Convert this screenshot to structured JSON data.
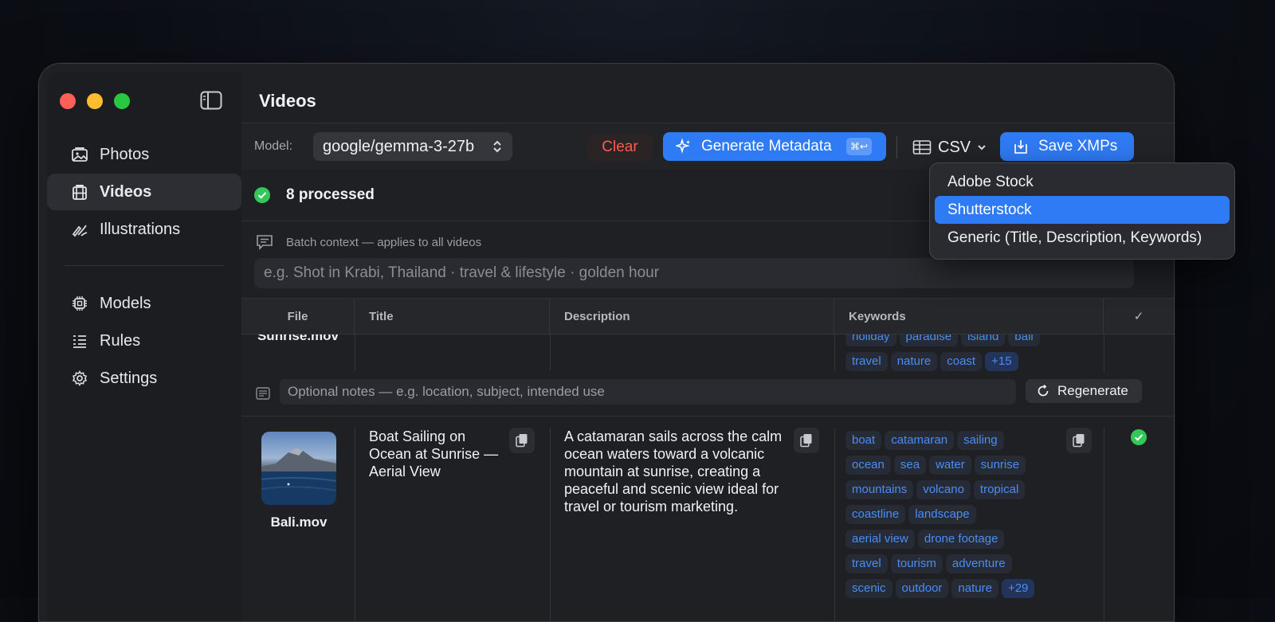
{
  "window": {
    "title": "Videos"
  },
  "sidebar": {
    "items": [
      {
        "label": "Photos",
        "icon": "photo-icon"
      },
      {
        "label": "Videos",
        "icon": "film-icon"
      },
      {
        "label": "Illustrations",
        "icon": "brush-icon"
      },
      {
        "label": "Models",
        "icon": "chip-icon"
      },
      {
        "label": "Rules",
        "icon": "list-icon"
      },
      {
        "label": "Settings",
        "icon": "gear-icon"
      }
    ],
    "active": "Videos"
  },
  "toolbar": {
    "model_label": "Model:",
    "model_value": "google/gemma-3-27b",
    "clear_label": "Clear",
    "generate_label": "Generate Metadata",
    "generate_shortcut": "⌘↩",
    "export_format": "CSV",
    "save_label": "Save XMPs"
  },
  "status": {
    "text": "8 processed"
  },
  "batch": {
    "label": "Batch context — applies to all videos",
    "placeholder": "e.g. Shot in Krabi, Thailand · travel & lifestyle · golden hour"
  },
  "table": {
    "headers": [
      "File",
      "Title",
      "Description",
      "Keywords",
      "✓"
    ],
    "rows": [
      {
        "file": "Sunrise.mov",
        "keywords_line1": [
          "holiday",
          "paradise",
          "island",
          "bali"
        ],
        "keywords_line2": [
          "travel",
          "nature",
          "coast",
          "+15"
        ],
        "notes_placeholder": "Optional notes — e.g. location, subject, intended use",
        "regenerate_label": "Regenerate"
      },
      {
        "file": "Bali.mov",
        "title": "Boat Sailing on Ocean at Sunrise — Aerial View",
        "description": "A catamaran sails across the calm ocean waters toward a volcanic mountain at sunrise, creating a peaceful and scenic view ideal for travel or tourism marketing.",
        "keywords": [
          "boat",
          "catamaran",
          "sailing",
          "ocean",
          "sea",
          "water",
          "sunrise",
          "mountains",
          "volcano",
          "tropical",
          "coastline",
          "landscape",
          "aerial view",
          "drone footage",
          "travel",
          "tourism",
          "adventure",
          "scenic",
          "outdoor",
          "nature",
          "+29"
        ]
      }
    ]
  },
  "dropdown": {
    "items": [
      "Adobe Stock",
      "Shutterstock",
      "Generic (Title, Description, Keywords)"
    ],
    "selected": "Shutterstock"
  },
  "colors": {
    "accent": "#2f7bf5",
    "danger": "#ff5a52",
    "success": "#34c759",
    "tag_text": "#4a8df5"
  }
}
